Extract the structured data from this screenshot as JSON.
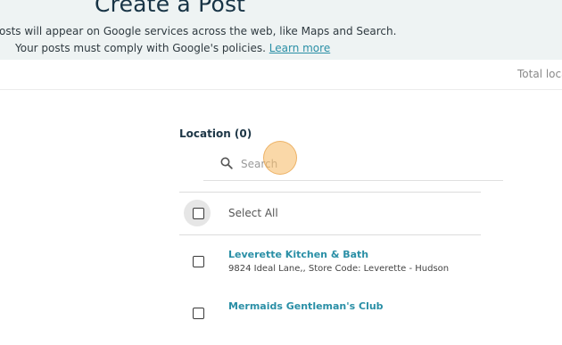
{
  "banner": {
    "title": "Create a Post",
    "line1": "osts will appear on Google services across the web, like Maps and Search.",
    "line2_prefix": "Your posts must comply with Google's policies. ",
    "learn_more": "Learn more"
  },
  "subbar": {
    "total_label": "Total loca"
  },
  "location": {
    "header": "Location (0)",
    "search_placeholder": "Search",
    "search_value": "",
    "select_all": "Select All",
    "items": [
      {
        "name": "Leverette Kitchen & Bath",
        "address": "9824 Ideal Lane,, Store Code: Leverette - Hudson"
      },
      {
        "name": "Mermaids Gentleman's Club",
        "address": ""
      }
    ]
  },
  "colors": {
    "accent": "#2a8fa6",
    "banner_bg": "#eef3f3",
    "title": "#183446",
    "cursor_highlight": "#f7be6e"
  },
  "icons": {
    "search": "search-icon",
    "checkbox": "checkbox-icon"
  }
}
